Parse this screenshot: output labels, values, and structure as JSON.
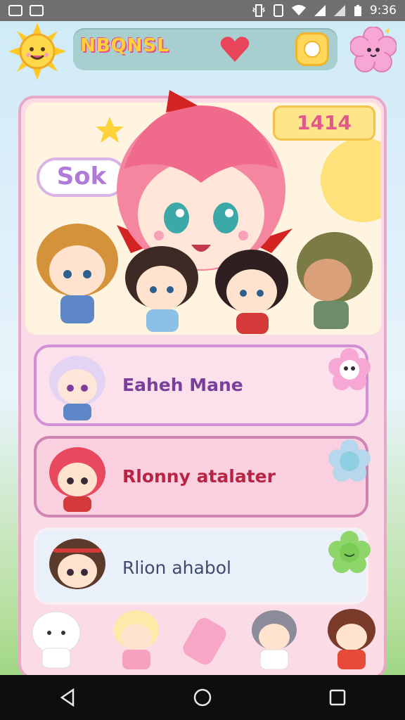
{
  "status_bar": {
    "time": "9:36"
  },
  "header": {
    "title": "NBQNSL"
  },
  "hero": {
    "badge_number": "1414",
    "logo_text": "Sok"
  },
  "list": {
    "items": [
      {
        "label": "Eaheh Mane"
      },
      {
        "label": "Rlonny atalater"
      },
      {
        "label": "Rlion ahabol"
      }
    ]
  },
  "colors": {
    "panel_border": "#e7a9c9",
    "panel_bg": "#fbdbe6",
    "topbar": "#a8cfcf",
    "accent_pink": "#e2568f",
    "accent_yellow": "#ffd23a"
  },
  "icons": {
    "sun": "sun-icon",
    "heart": "heart-icon",
    "circle": "circle-icon",
    "flower": "flower-icon",
    "back": "back-icon",
    "home": "home-icon",
    "recents": "recents-icon"
  }
}
